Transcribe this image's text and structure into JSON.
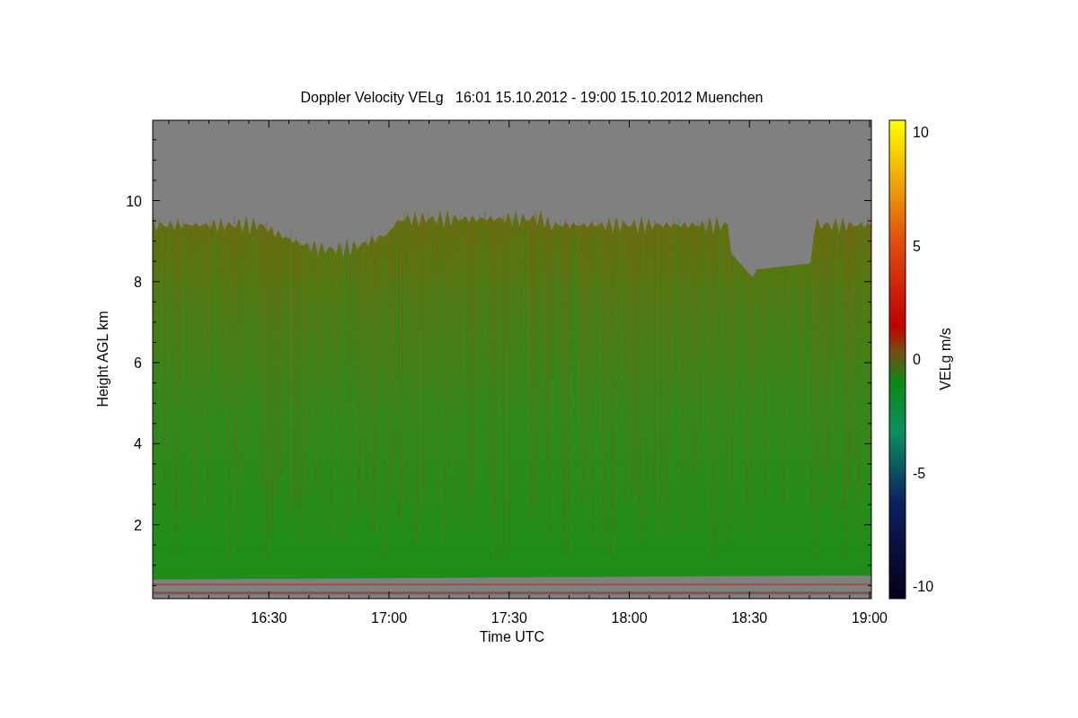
{
  "title": "Doppler Velocity VELg   16:01 15.10.2012 - 19:00 15.10.2012 Muenchen",
  "y_axis": {
    "label": "Height AGL km",
    "ticks": [
      "10",
      "8",
      "6",
      "4",
      "2"
    ]
  },
  "x_axis": {
    "label": "Time UTC",
    "ticks": [
      "16:30",
      "17:00",
      "17:30",
      "18:00",
      "18:30",
      "19:00"
    ]
  },
  "colorbar": {
    "label": "VELg m/s",
    "ticks": [
      "10",
      "5",
      "0",
      "-5",
      "-10"
    ]
  }
}
